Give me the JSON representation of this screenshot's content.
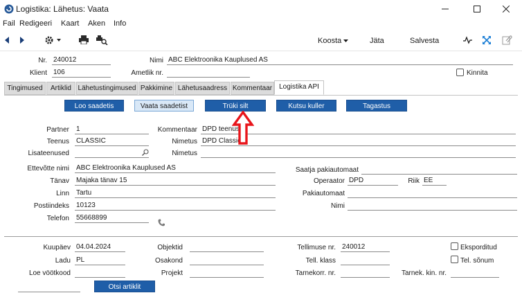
{
  "window": {
    "title": "Logistika: Lähetus: Vaata"
  },
  "menu": [
    "Fail",
    "Redigeeri",
    "Kaart",
    "Aken",
    "Info"
  ],
  "toolbar": {
    "koosta": "Koosta",
    "jata": "Jäta",
    "salvesta": "Salvesta"
  },
  "header": {
    "nr_label": "Nr.",
    "nr_value": "240012",
    "nimi_label": "Nimi",
    "nimi_value": "ABC Elektroonika Kauplused AS",
    "klient_label": "Klient",
    "klient_value": "106",
    "ametlik_label": "Ametlik nr.",
    "ametlik_value": "",
    "kinnita_label": "Kinnita"
  },
  "tabs": [
    "Tingimused",
    "Artiklid",
    "Lähetustingimused",
    "Pakkimine",
    "Lähetusaadress",
    "Kommentaar",
    "Logistika API"
  ],
  "actions": {
    "loo": "Loo saadetis",
    "vaata": "Vaata saadetist",
    "truki": "Trüki silt",
    "kutsu": "Kutsu kuller",
    "tagastus": "Tagastus"
  },
  "api": {
    "partner_label": "Partner",
    "partner_value": "1",
    "kommentaar_label": "Kommentaar",
    "kommentaar_value": "DPD teenused",
    "teenus_label": "Teenus",
    "teenus_value": "CLASSIC",
    "nimetus_label": "Nimetus",
    "nimetus_value": "DPD Classic",
    "lisateenused_label": "Lisateenused",
    "lisateenused_value": "",
    "nimetus2_label": "Nimetus",
    "nimetus2_value": "",
    "ettevote_label": "Ettevõtte nimi",
    "ettevote_value": "ABC Elektroonika Kauplused AS",
    "saatja_label": "Saatja pakiautomaat",
    "saatja_value": "",
    "tanav_label": "Tänav",
    "tanav_value": "Majaka tänav 15",
    "operaator_label": "Operaator",
    "operaator_value": "DPD",
    "riik_label": "Riik",
    "riik_value": "EE",
    "linn_label": "Linn",
    "linn_value": "Tartu",
    "pakiautomaat_label": "Pakiautomaat",
    "pakiautomaat_value": "",
    "postiindeks_label": "Postiindeks",
    "postiindeks_value": "10123",
    "nimi_label": "Nimi",
    "nimi_value": "",
    "telefon_label": "Telefon",
    "telefon_value": "55668899"
  },
  "footer": {
    "kuupaev_label": "Kuupäev",
    "kuupaev_value": "04.04.2024",
    "objektid_label": "Objektid",
    "objektid_value": "",
    "tellimuse_label": "Tellimuse nr.",
    "tellimuse_value": "240012",
    "eksporditud_label": "Eksporditud",
    "ladu_label": "Ladu",
    "ladu_value": "PL",
    "osakond_label": "Osakond",
    "osakond_value": "",
    "tellklass_label": "Tell. klass",
    "tellklass_value": "",
    "telsonum_label": "Tel. sõnum",
    "loe_label": "Loe vöötkood",
    "loe_value": "",
    "projekt_label": "Projekt",
    "projekt_value": "",
    "tarnekorr_label": "Tarnekorr. nr.",
    "tarnekorr_value": "",
    "tarnekkin_label": "Tarnek. kin. nr.",
    "tarnekkin_value": "",
    "otsi_label": "Otsi artiklit"
  },
  "colors": {
    "button_blue": "#1f5ea8",
    "button_light": "#d9e8f7",
    "annotation_red": "#e8151b",
    "icon_blue": "#1c7fd6"
  }
}
